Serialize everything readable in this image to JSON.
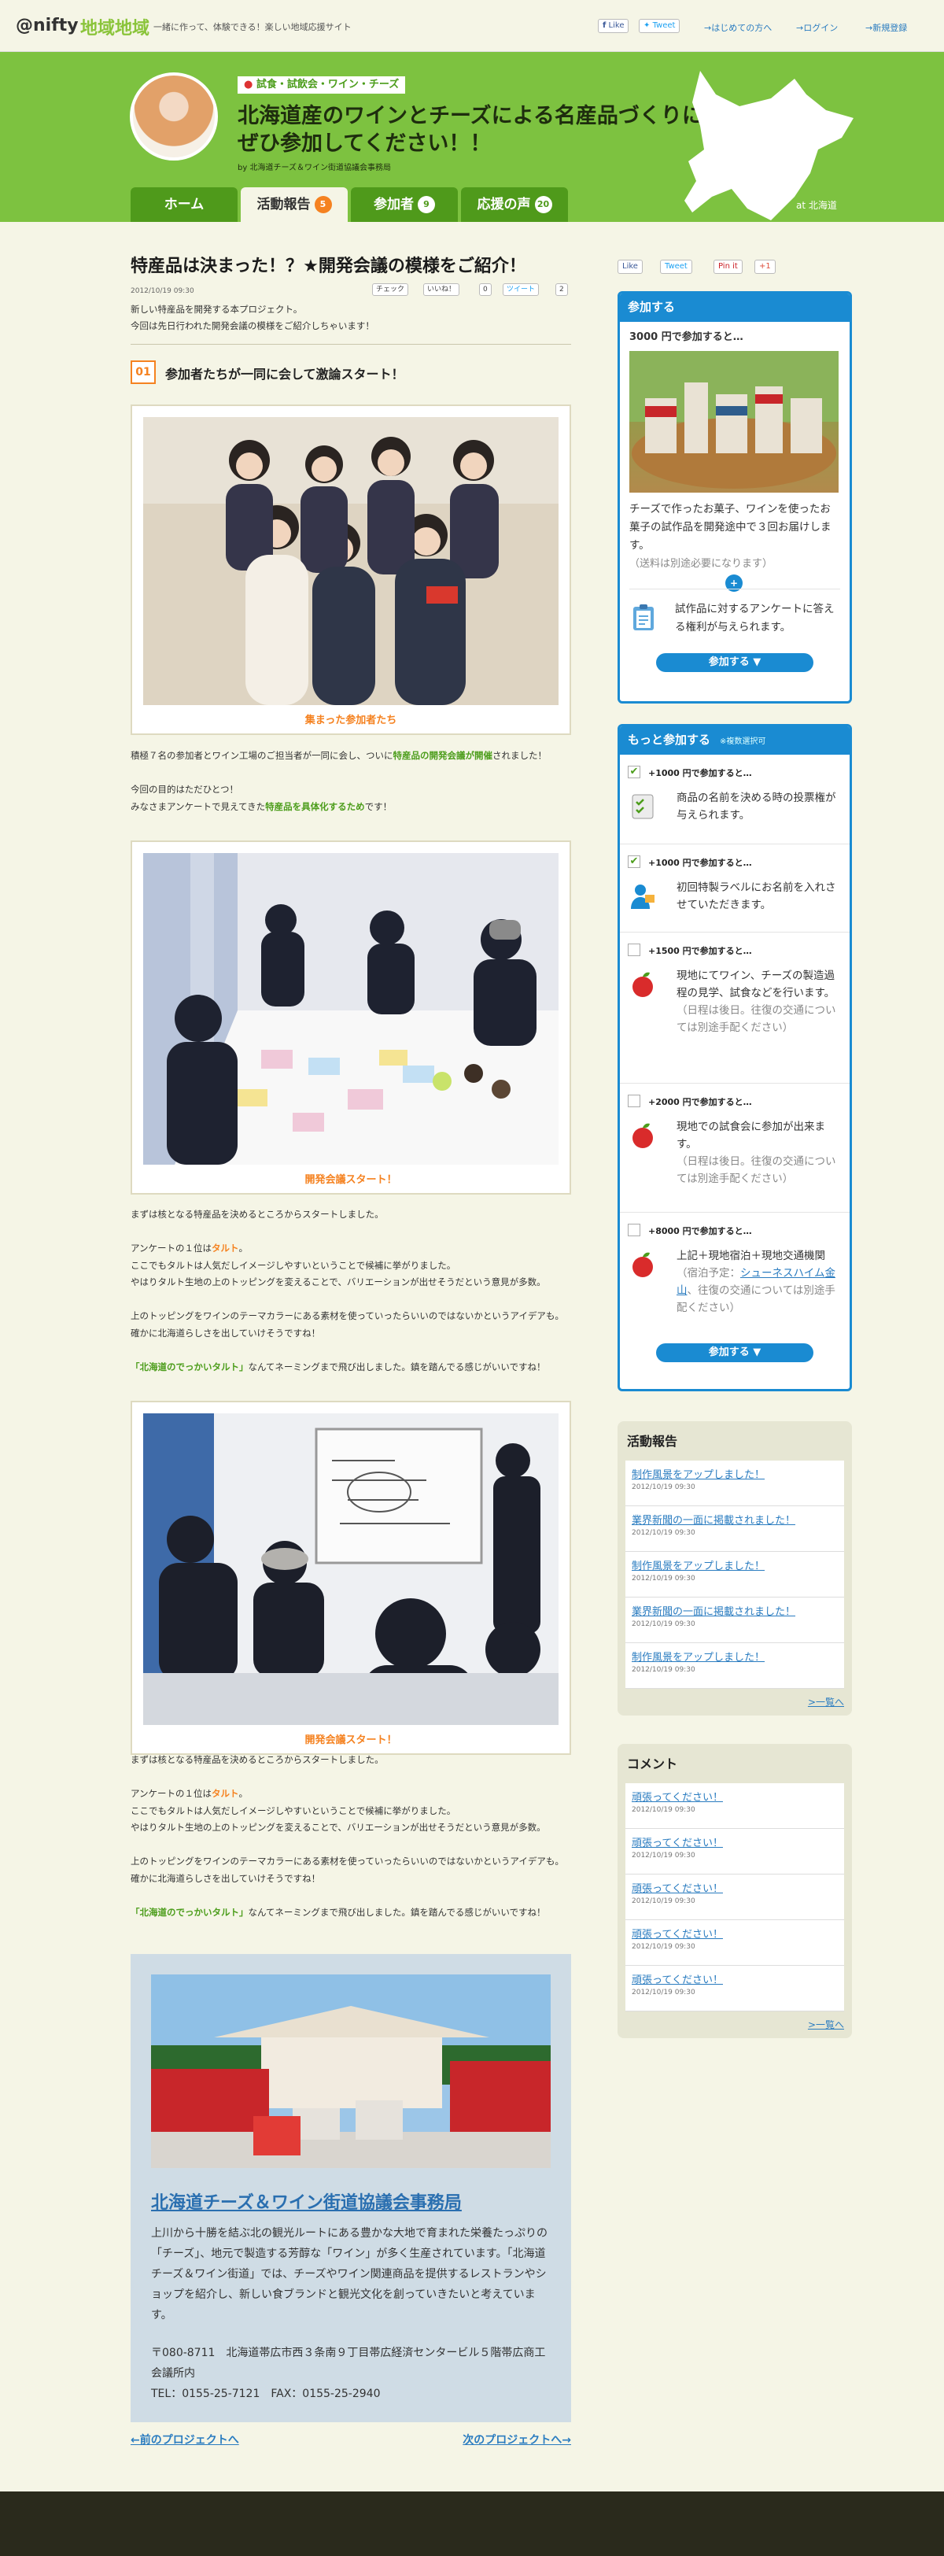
{
  "header": {
    "logo_nifty": "@nifty",
    "logo_chiiki": "地域地域",
    "tagline": "一緒に作って、体験できる！楽しい地域応援サイト",
    "fb_like": "Like",
    "tweet": "Tweet",
    "link_beginner": "→はじめての方へ",
    "link_login": "→ログイン",
    "link_register": "→新規登録"
  },
  "hero": {
    "categories": "試食・試飲会・ワイン・チーズ",
    "title_line1": "北海道産のワインとチーズによる名産品づくりに",
    "title_line2": "ぜひ参加してください！！",
    "by": "by 北海道チーズ＆ワイン街道協議会事務局",
    "location": "at 北海道"
  },
  "tabs": [
    {
      "label": "ホーム",
      "badge": ""
    },
    {
      "label": "活動報告",
      "badge": "5"
    },
    {
      "label": "参加者",
      "badge": "9"
    },
    {
      "label": "応援の声",
      "badge": "20"
    }
  ],
  "post": {
    "title": "特産品は決まった！？★開発会議の模様をご紹介！",
    "date": "2012/10/19 09:30",
    "share_check": "チェック",
    "share_like": "いいね！",
    "share_like_count": "0",
    "share_tweet": "ツイート",
    "share_tweet_count": "2",
    "intro_line1": "新しい特産品を開発する本プロジェクト。",
    "intro_line2": "今回は先日行われた開発会議の模様をご紹介しちゃいます！",
    "section_num": "01",
    "section_title": "参加者たちが一同に会して激論スタート！",
    "photo1_caption": "集まった参加者たち",
    "p1_a": "積極７名の参加者とワイン工場のご担当者が一同に会し、ついに",
    "p1_b": "特産品の開発会議が開催",
    "p1_c": "されました！",
    "p2_line1": "今回の目的はただひとつ！",
    "p2_a": "みなさまアンケートで見えてきた",
    "p2_b": "特産品を具体化するため",
    "p2_c": "です！",
    "photo2_caption": "開発会議スタート！",
    "photo3_caption": "開発会議スタート！",
    "body": {
      "l1": "まずは核となる特産品を決めるところからスタートしました。",
      "l2_a": "アンケートの１位は",
      "l2_b": "タルト",
      "l2_c": "。",
      "l3": "ここでもタルトは人気だしイメージしやすいということで候補に挙がりました。",
      "l4": "やはりタルト生地の上のトッピングを変えることで、バリエーションが出せそうだという意見が多数。",
      "l5": "上のトッピングをワインのテーマカラーにある素材を使っていったらいいのではないかというアイデアも。確かに北海道らしさを出していけそうですね！",
      "l6_a": "「北海道のでっかいタルト」",
      "l6_b": "なんてネーミングまで飛び出しました。鎮を踏んでる感じがいいですね！"
    },
    "office_name": "北海道チーズ＆ワイン街道協議会事務局",
    "office_desc": "上川から十勝を結ぶ北の観光ルートにある豊かな大地で育まれた栄養たっぷりの「チーズ」、地元で製造する芳醇な「ワイン」が多く生産されています。「北海道チーズ＆ワイン街道」では、チーズやワイン関連商品を提供するレストランやショップを紹介し、新しい食ブランドと観光文化を創っていきたいと考えています。",
    "office_addr1": "〒080-8711　北海道帯広市西３条南９丁目帯広経済センタービル５階帯広商工会議所内",
    "office_addr2": "TEL：0155-25-7121　FAX：0155-25-2940",
    "prev": "←前のプロジェクトへ",
    "next": "次のプロジェクトへ→"
  },
  "sidebar": {
    "share": [
      "Like",
      "Tweet",
      "Pin it",
      "+1"
    ],
    "join_box": {
      "title": "参加する",
      "price": "3000 円で参加すると…",
      "desc": "チーズで作ったお菓子、ワインを使ったお菓子の試作品を開発途中で３回お届けします。",
      "note": "（送料は別途必要になります）",
      "plus_desc": "試作品に対するアンケートに答える権利が与えられます。",
      "button": "参加する ▼"
    },
    "more_box": {
      "title": "もっと参加する",
      "note": "※複数選択可",
      "tiers": [
        {
          "price": "+1000 円で参加すると…",
          "desc": "商品の名前を決める時の投票権が与えられます。",
          "note": "",
          "checked": "✔"
        },
        {
          "price": "+1000 円で参加すると…",
          "desc": "初回特製ラベルにお名前を入れさせていただきます。",
          "note": "",
          "checked": "✔"
        },
        {
          "price": "+1500 円で参加すると…",
          "desc": "現地にてワイン、チーズの製造過程の見学、試食などを行います。",
          "note": "（日程は後日。往復の交通については別途手配ください）",
          "checked": ""
        },
        {
          "price": "+2000 円で参加すると…",
          "desc": "現地での試食会に参加が出来ます。",
          "note": "（日程は後日。往復の交通については別途手配ください）",
          "checked": ""
        },
        {
          "price": "+8000 円で参加すると…",
          "desc": "上記＋現地宿泊＋現地交通機関",
          "note_a": "（宿泊予定：",
          "note_link": "シューネスハイム金山",
          "note_b": "、往復の交通については別途手配ください）",
          "checked": ""
        }
      ],
      "button": "参加する ▼"
    },
    "reports": {
      "title": "活動報告",
      "items": [
        {
          "label": "制作風景をアップしました！",
          "date": "2012/10/19 09:30"
        },
        {
          "label": "業界新聞の一面に掲載されました！",
          "date": "2012/10/19 09:30"
        },
        {
          "label": "制作風景をアップしました！",
          "date": "2012/10/19 09:30"
        },
        {
          "label": "業界新聞の一面に掲載されました！",
          "date": "2012/10/19 09:30"
        },
        {
          "label": "制作風景をアップしました！",
          "date": "2012/10/19 09:30"
        }
      ],
      "more": ">一覧へ"
    },
    "comments": {
      "title": "コメント",
      "items": [
        {
          "label": "頑張ってください！",
          "date": "2012/10/19 09:30"
        },
        {
          "label": "頑張ってください！",
          "date": "2012/10/19 09:30"
        },
        {
          "label": "頑張ってください！",
          "date": "2012/10/19 09:30"
        },
        {
          "label": "頑張ってください！",
          "date": "2012/10/19 09:30"
        },
        {
          "label": "頑張ってください！",
          "date": "2012/10/19 09:30"
        }
      ],
      "more": ">一覧へ"
    }
  },
  "colors": {
    "brand_green": "#7dc240",
    "accent_orange": "#f58220",
    "link_blue": "#2a7cc0",
    "box_blue": "#1a8bd2"
  }
}
